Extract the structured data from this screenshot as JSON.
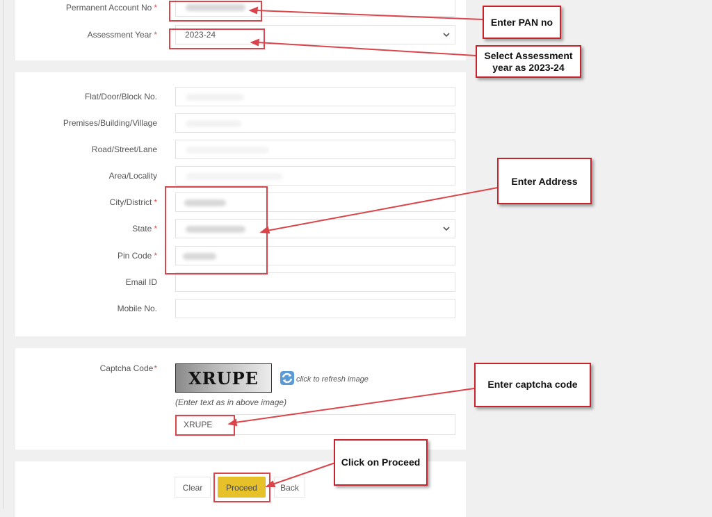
{
  "section_pan": {
    "pan": {
      "label": "Permanent Account No",
      "required_mark": "*",
      "value_state": "blurred"
    },
    "assessment_year": {
      "label": "Assessment Year",
      "required_mark": "*",
      "selected": "2023-24",
      "icon": "chevron-down-icon"
    }
  },
  "section_address": {
    "fields": [
      {
        "label": "Flat/Door/Block No.",
        "required": false,
        "value_state": "blurred-faint"
      },
      {
        "label": "Premises/Building/Village",
        "required": false,
        "value_state": "blurred-faint"
      },
      {
        "label": "Road/Street/Lane",
        "required": false,
        "value_state": "blurred-faint"
      },
      {
        "label": "Area/Locality",
        "required": false,
        "value_state": "blurred-faint"
      },
      {
        "label": "City/District",
        "required": true,
        "value_state": "blurred"
      },
      {
        "label": "State",
        "required": true,
        "type": "select",
        "value_state": "blurred"
      },
      {
        "label": "Pin Code",
        "required": true,
        "value_state": "blurred"
      },
      {
        "label": "Email ID",
        "required": false,
        "value_state": "empty"
      },
      {
        "label": "Mobile No.",
        "required": false,
        "value_state": "empty"
      }
    ],
    "required_mark": "*"
  },
  "section_captcha": {
    "label": "Captcha Code",
    "required_mark": "*",
    "captcha_image_text": "XRUPE",
    "refresh_icon": "refresh-icon",
    "refresh_text": "click to refresh image",
    "hint": "(Enter text as in above image)",
    "input_value": "XRUPE"
  },
  "actions": {
    "clear": "Clear",
    "proceed": "Proceed",
    "back": "Back"
  },
  "annotations": {
    "pan": "Enter PAN no",
    "assessment_year_line1": "Select Assessment",
    "assessment_year_line2": "year as 2023-24",
    "address": "Enter Address",
    "captcha": "Enter captcha code",
    "proceed": "Click on Proceed"
  },
  "colors": {
    "background": "#f0f0f0",
    "panel": "#ffffff",
    "required": "#d9534f",
    "proceed_button": "#e6c12a",
    "annotation_border": "#c8232c"
  }
}
